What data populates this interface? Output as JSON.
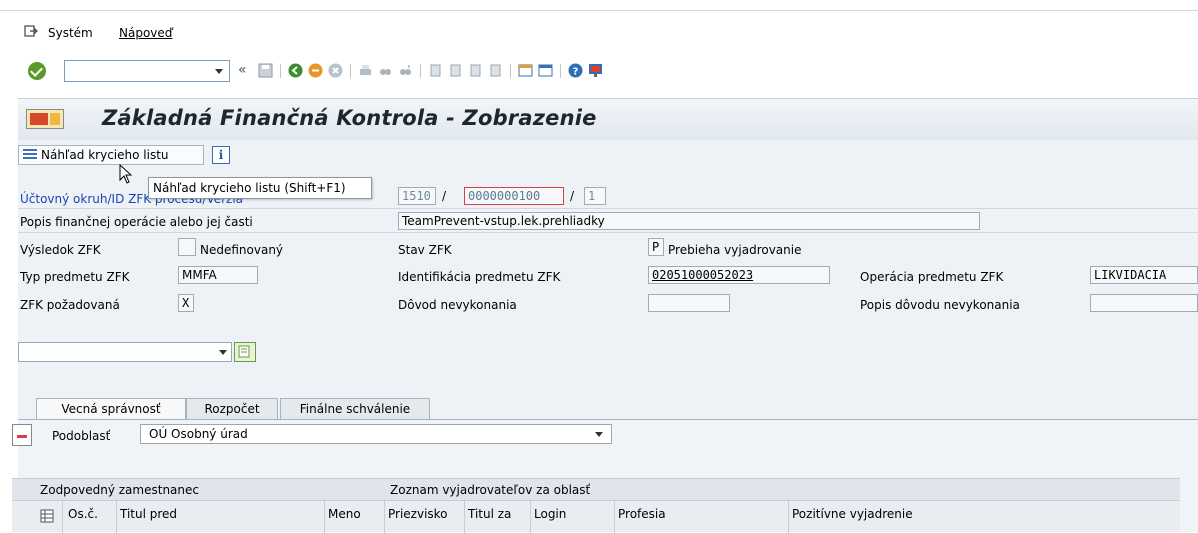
{
  "menubar": {
    "system": "Systém",
    "system_underline": "y",
    "help": "Nápoveď"
  },
  "window": {
    "title": "Základná Finančná Kontrola - Zobrazenie"
  },
  "app_toolbar": {
    "preview_button": "Náhľad krycieho listu",
    "info_button": "i",
    "tooltip": "Náhľad krycieho listu   (Shift+F1)"
  },
  "form": {
    "ucet_label": "Účtovný okruh/ID ZFK procesu/Verzia",
    "ucet_values": {
      "okruh": "1510",
      "id": "0000000100",
      "verzia": "1",
      "sep": "/"
    },
    "popis_label": "Popis finančnej operácie alebo jej časti",
    "popis_value": "TeamPrevent-vstup.lek.prehliadky",
    "vysledok_label": "Výsledok ZFK",
    "vysledok_value": "Nedefinovaný",
    "stav_label": "Stav ZFK",
    "stav_code": "P",
    "stav_value": "Prebieha vyjadrovanie",
    "typ_label": "Typ predmetu ZFK",
    "typ_value": "MMFA",
    "ident_label": "Identifikácia predmetu ZFK",
    "ident_value": "02051000052023",
    "operacia_label": "Operácia predmetu ZFK",
    "operacia_value": "LIKVIDACIA",
    "pozadovana_label": "ZFK požadovaná",
    "pozadovana_value": "X",
    "dovod_label": "Dôvod nevykonania",
    "popis_dovodu_label": "Popis dôvodu nevykonania"
  },
  "tabs": [
    {
      "label": "Vecná správnosť"
    },
    {
      "label": "Rozpočet"
    },
    {
      "label": "Finálne schválenie"
    }
  ],
  "tab_content": {
    "podoblast_label": "Podoblasť",
    "podoblast_value": "OÚ Osobný úrad",
    "group_head_left": "Zodpovedný zamestnanec",
    "group_head_right": "Zoznam vyjadrovateľov za oblasť",
    "columns": [
      "Os.č.",
      "Titul pred",
      "Meno",
      "Priezvisko",
      "Titul za",
      "Login",
      "Profesia",
      "Pozitívne vyjadrenie"
    ]
  },
  "colors": {
    "accent": "#1846b0",
    "panel": "#eef2f6",
    "error_border": "#d64040"
  }
}
